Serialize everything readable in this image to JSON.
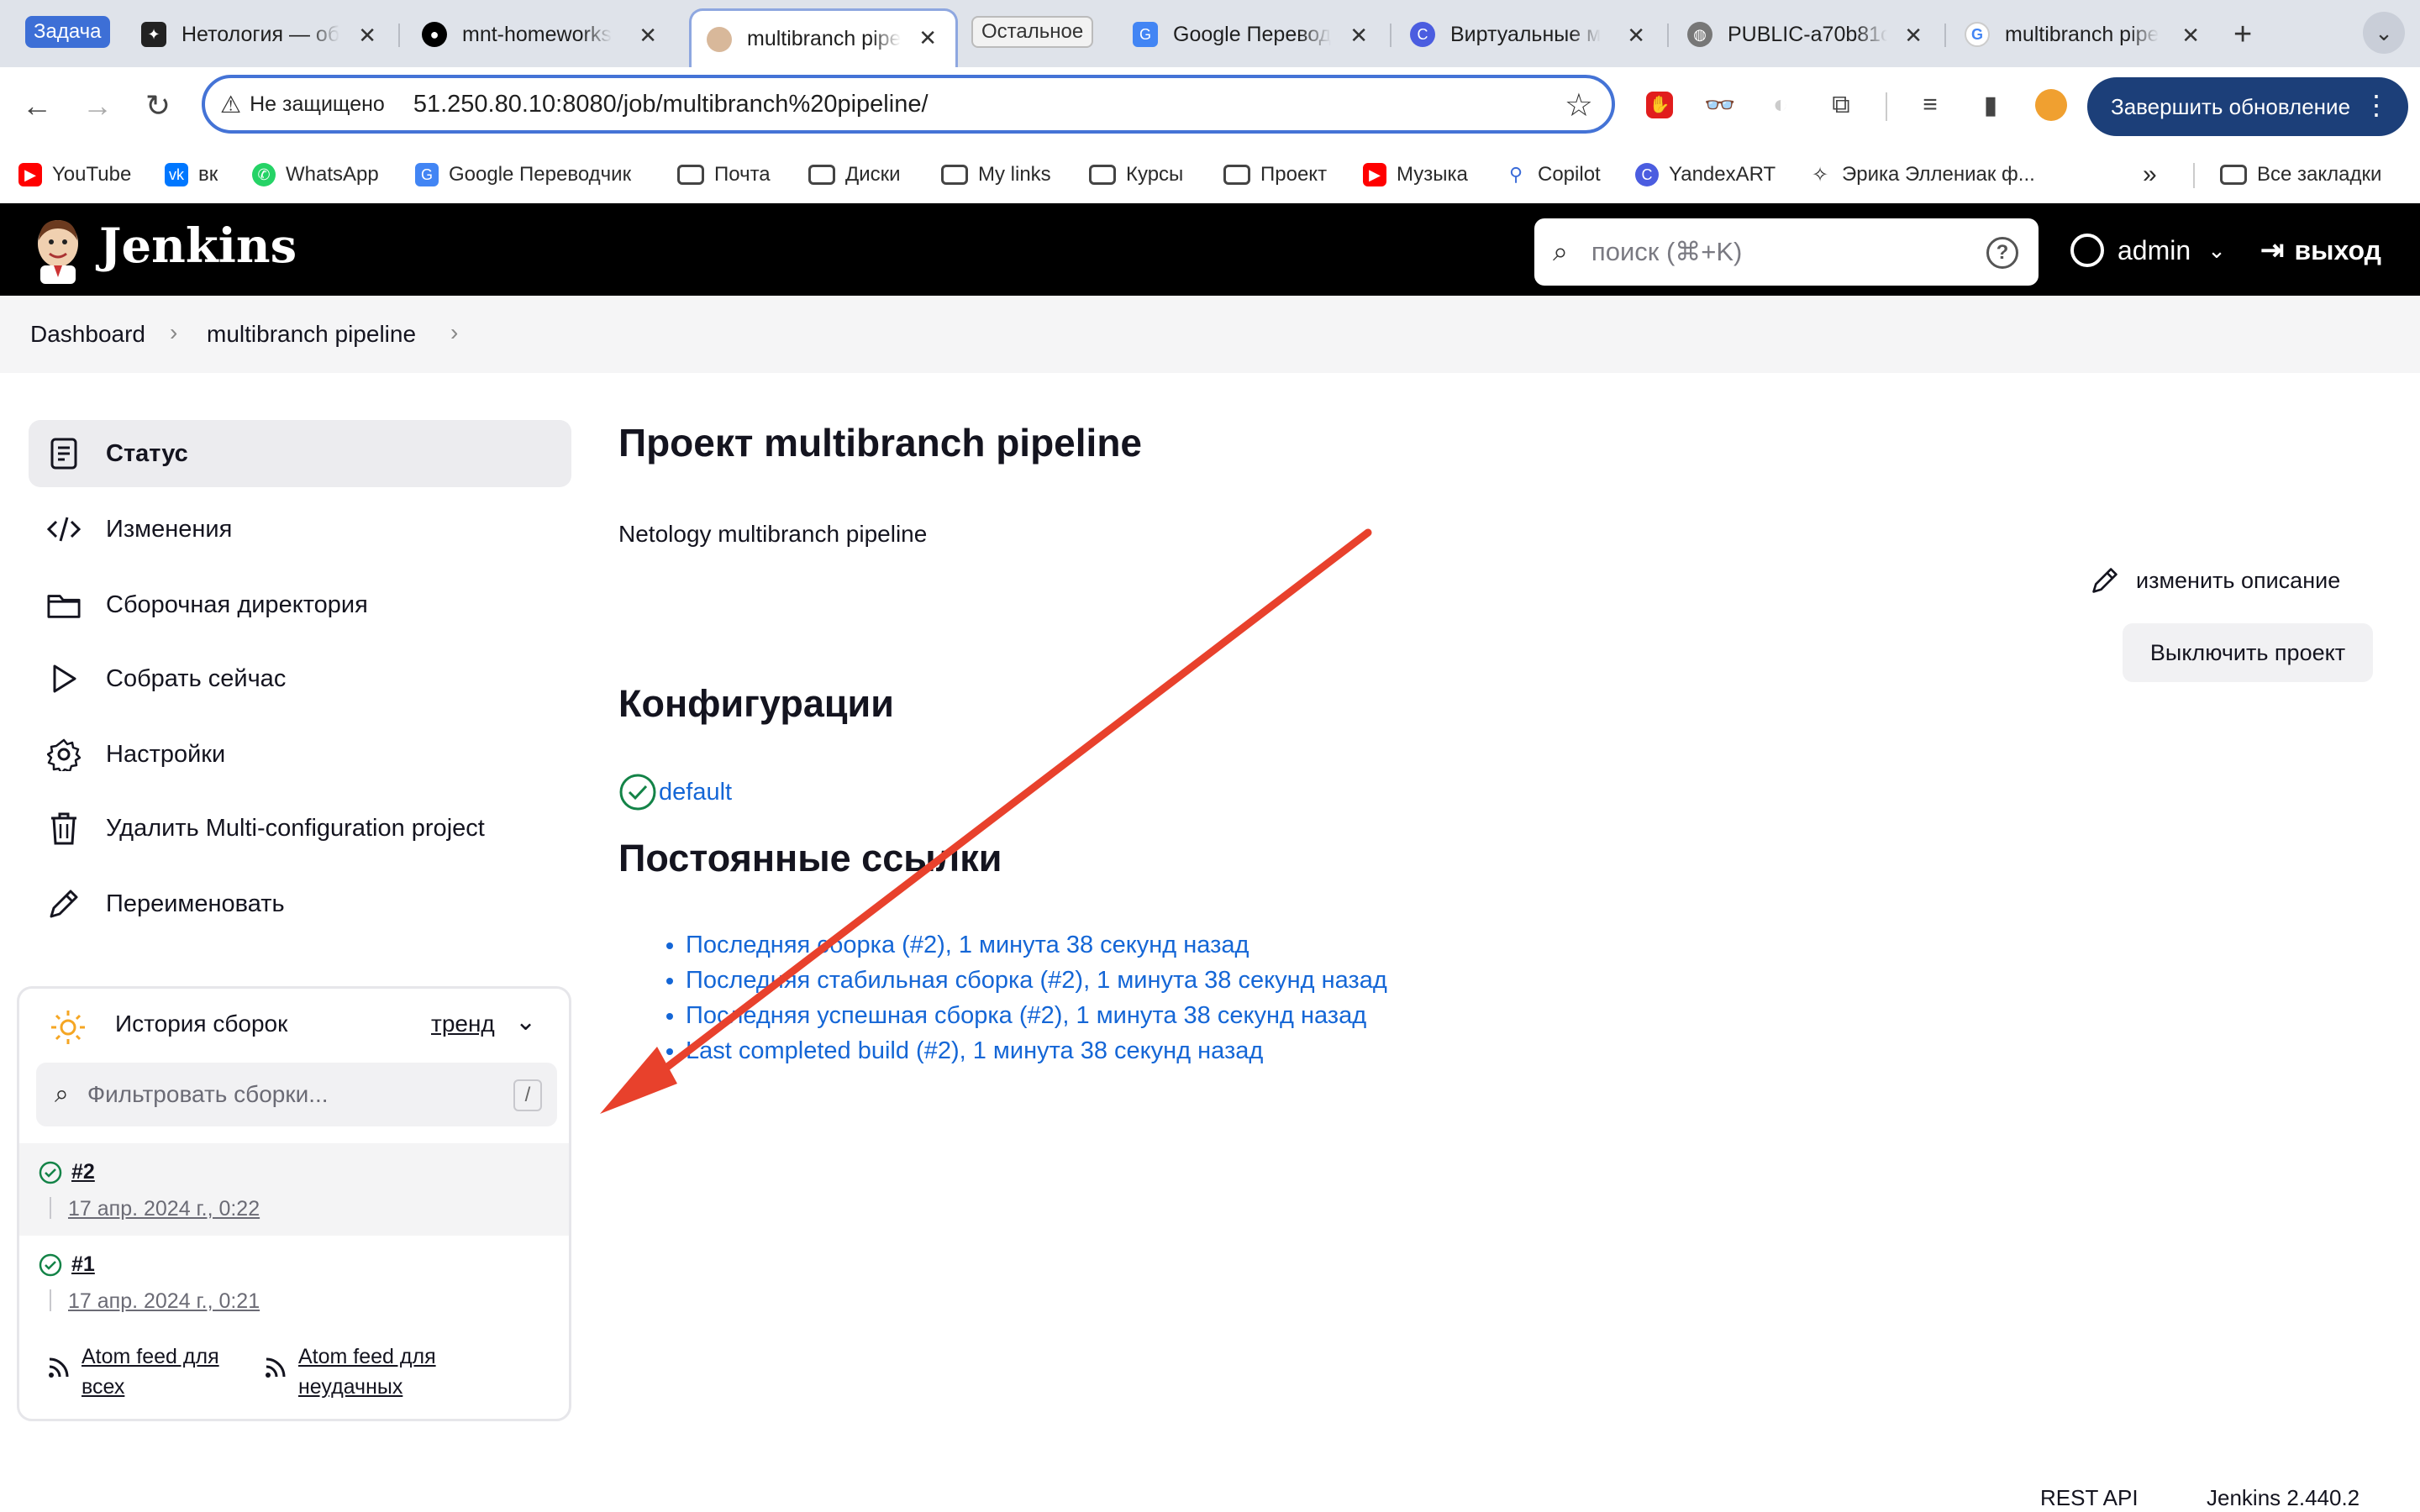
{
  "browser": {
    "tabs": [
      {
        "label": "Нетология — об",
        "icon": "netology-icon"
      },
      {
        "label": "mnt-homeworks",
        "icon": "github-icon"
      },
      {
        "label": "multibranch pipe",
        "icon": "jenkins-icon",
        "active": true
      },
      {
        "label": "Google Перевод",
        "icon": "google-translate-icon"
      },
      {
        "label": "Виртуальные м",
        "icon": "cloud-icon"
      },
      {
        "label": "PUBLIC-a70b81c",
        "icon": "globe-icon"
      },
      {
        "label": "multibranch pipe",
        "icon": "google-icon"
      }
    ],
    "group_chips": {
      "task": "Задача",
      "other": "Остальное"
    },
    "omnibox": {
      "insecure_label": "Не защищено",
      "url": "51.250.80.10:8080/job/multibranch%20pipeline/"
    },
    "update_button": "Завершить обновление",
    "bookmarks": [
      {
        "label": "YouTube",
        "icon": "youtube-icon",
        "color": "#ff0000"
      },
      {
        "label": "вк",
        "icon": "vk-icon",
        "color": "#0077ff"
      },
      {
        "label": "WhatsApp",
        "icon": "whatsapp-icon",
        "color": "#25d366"
      },
      {
        "label": "Google Переводчик",
        "icon": "google-translate-icon",
        "color": "#4285f4"
      },
      {
        "label": "Почта",
        "icon": "folder-icon"
      },
      {
        "label": "Диски",
        "icon": "folder-icon"
      },
      {
        "label": "My links",
        "icon": "folder-icon"
      },
      {
        "label": "Курсы",
        "icon": "folder-icon"
      },
      {
        "label": "Проект",
        "icon": "folder-icon"
      },
      {
        "label": "Музыка",
        "icon": "youtube-music-icon",
        "color": "#ff0000"
      },
      {
        "label": "Copilot",
        "icon": "copilot-icon"
      },
      {
        "label": "YandexART",
        "icon": "yandexart-icon"
      },
      {
        "label": "Эрика Эллениак ф...",
        "icon": "star-page-icon"
      }
    ],
    "all_bookmarks": "Все закладки"
  },
  "jenkins": {
    "logo_text": "Jenkins",
    "search_placeholder": "поиск (⌘+K)",
    "user": "admin",
    "logout": "выход"
  },
  "breadcrumb": [
    "Dashboard",
    "multibranch pipeline"
  ],
  "sidebar": {
    "items": [
      {
        "label": "Статус",
        "icon": "notepad-icon",
        "active": true
      },
      {
        "label": "Изменения",
        "icon": "code-icon"
      },
      {
        "label": "Сборочная директория",
        "icon": "folder-icon"
      },
      {
        "label": "Собрать сейчас",
        "icon": "play-icon"
      },
      {
        "label": "Настройки",
        "icon": "gear-icon"
      },
      {
        "label": "Удалить Multi-configuration project",
        "icon": "trash-icon"
      },
      {
        "label": "Переименовать",
        "icon": "pencil-icon"
      }
    ]
  },
  "build_history": {
    "title": "История сборок",
    "trend": "тренд",
    "filter_placeholder": "Фильтровать сборки...",
    "filter_shortcut": "/",
    "builds": [
      {
        "number": "#2",
        "date": "17 апр. 2024 г., 0:22",
        "status": "success"
      },
      {
        "number": "#1",
        "date": "17 апр. 2024 г., 0:21",
        "status": "success"
      }
    ],
    "feeds": [
      {
        "line1": "Atom feed для",
        "line2": "всех"
      },
      {
        "line1": "Atom feed для",
        "line2": "неудачных"
      }
    ]
  },
  "main": {
    "title": "Проект multibranch pipeline",
    "description": "Netology multibranch pipeline",
    "edit_description": "изменить описание",
    "disable_button": "Выключить проект",
    "config_heading": "Конфигурации",
    "config_item": "default",
    "permalinks_heading": "Постоянные ссылки",
    "permalinks": [
      "Последняя сборка (#2), 1 минута 38 секунд назад",
      "Последняя стабильная сборка (#2), 1 минута 38 секунд назад",
      "Последняя успешная сборка (#2), 1 минута 38 секунд назад",
      "Last completed build (#2), 1 минута 38 секунд назад"
    ]
  },
  "footer": {
    "rest_api": "REST API",
    "version": "Jenkins 2.440.2"
  },
  "colors": {
    "link": "#1466d6",
    "success": "#138347",
    "annotation_arrow": "#e8412c",
    "header": "#000000"
  }
}
